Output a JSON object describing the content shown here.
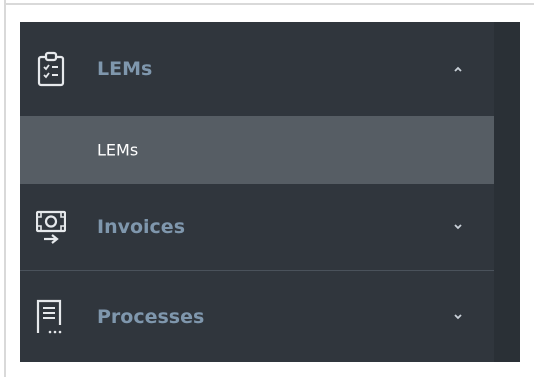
{
  "menu": {
    "sections": [
      {
        "label": "LEMs",
        "icon": "clipboard-checklist-icon",
        "expanded": true
      },
      {
        "label": "Invoices",
        "icon": "money-transfer-icon",
        "expanded": false
      },
      {
        "label": "Processes",
        "icon": "document-icon",
        "expanded": false
      }
    ],
    "subitems": [
      {
        "label": "LEMs",
        "selected": true
      }
    ]
  },
  "colors": {
    "sidebar_bg": "#30363d",
    "selected_bg": "#565d64",
    "section_label": "#7f97ad",
    "subitem_label": "#ffffff"
  }
}
